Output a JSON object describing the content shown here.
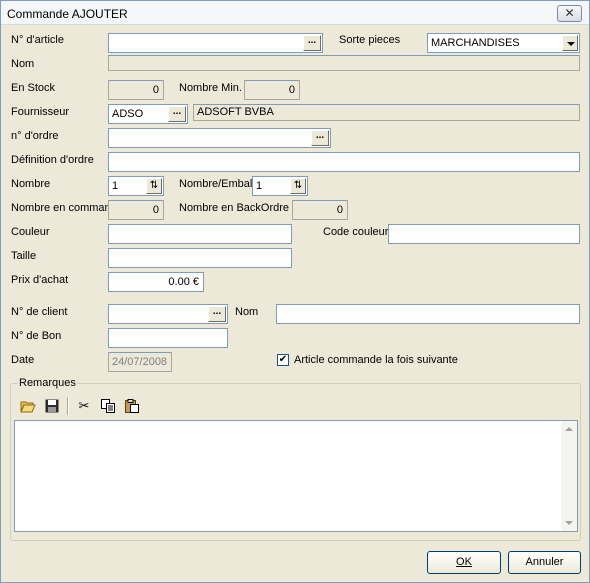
{
  "window": {
    "title": "Commande AJOUTER",
    "close_glyph": "✕"
  },
  "labels": {
    "article_no": "N° d'article",
    "sorte_pieces": "Sorte pieces",
    "nom": "Nom",
    "en_stock": "En Stock",
    "nombre_min": "Nombre Min.",
    "fournisseur": "Fournisseur",
    "no_ordre": "n° d'ordre",
    "definition_ordre": "Définition d'ordre",
    "nombre": "Nombre",
    "nombre_emballage": "Nombre/Emballa",
    "nombre_en_commande": "Nombre en commanc",
    "nombre_en_backordre": "Nombre en BackOrdre",
    "couleur": "Couleur",
    "code_couleur": "Code couleur",
    "taille": "Taille",
    "prix_achat": "Prix d'achat",
    "no_client": "N° de client",
    "nom_client": "Nom",
    "no_bon": "N° de Bon",
    "date": "Date",
    "article_commande": "Article commande la fois suivante",
    "remarques": "Remarques"
  },
  "fields": {
    "article_no": "",
    "sorte_pieces": "MARCHANDISES",
    "nom": "",
    "en_stock": "0",
    "nombre_min": "0",
    "fournisseur_code": "ADSO",
    "fournisseur_name": "ADSOFT BVBA",
    "no_ordre": "",
    "definition_ordre": "",
    "nombre": "1",
    "nombre_emballage": "1",
    "nombre_en_commande": "0",
    "nombre_en_backordre": "0",
    "couleur": "",
    "code_couleur": "",
    "taille": "",
    "prix_achat": "0.00 €",
    "no_client": "",
    "nom_client": "",
    "no_bon": "",
    "date": "24/07/2008",
    "article_commande_checked": true,
    "remarques": ""
  },
  "pick_button_label": "...",
  "toolbar": {
    "icons": [
      "open-folder-icon",
      "save-disk-icon",
      "cut-scissors-icon",
      "copy-icon",
      "paste-icon"
    ]
  },
  "buttons": {
    "ok": "OK",
    "annuler": "Annuler"
  },
  "colors": {
    "window_bg": "#ece9d8",
    "field_border": "#7f9db9",
    "button_border": "#003c74"
  }
}
